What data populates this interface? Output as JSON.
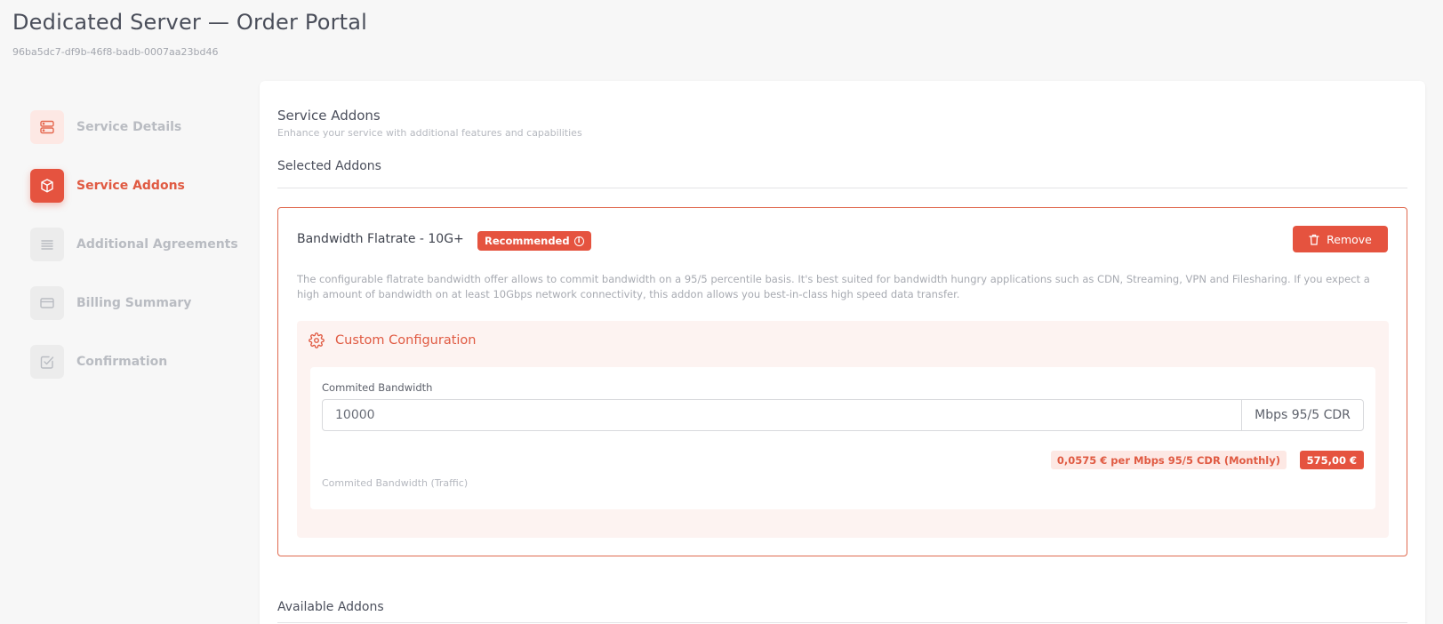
{
  "header": {
    "title": "Dedicated Server — Order Portal",
    "order_id": "96ba5dc7-df9b-46f8-badb-0007aa23bd46"
  },
  "steps": [
    {
      "label": "Service Details",
      "icon": "server-icon",
      "state": "done"
    },
    {
      "label": "Service Addons",
      "icon": "box-icon",
      "state": "active"
    },
    {
      "label": "Additional Agreements",
      "icon": "lines-icon",
      "state": "pending"
    },
    {
      "label": "Billing Summary",
      "icon": "card-icon",
      "state": "pending"
    },
    {
      "label": "Confirmation",
      "icon": "checkbox-icon",
      "state": "pending"
    }
  ],
  "section": {
    "title": "Service Addons",
    "subtitle": "Enhance your service with additional features and capabilities",
    "selected_heading": "Selected Addons",
    "available_heading": "Available Addons"
  },
  "addon": {
    "name": "Bandwidth Flatrate - 10G+",
    "badge": "Recommended",
    "remove_label": "Remove",
    "description": "The configurable flatrate bandwidth offer allows to commit bandwidth on a 95/5 percentile basis. It's best suited for bandwidth hungry applications such as CDN, Streaming, VPN and Filesharing. If you expect a high amount of bandwidth on at least 10Gbps network connectivity, this addon allows you best-in-class high speed data transfer.",
    "config": {
      "heading": "Custom Configuration",
      "field_label": "Commited Bandwidth",
      "value": "10000",
      "unit": "Mbps 95/5 CDR",
      "unit_price": "0,0575 € per Mbps 95/5 CDR (Monthly)",
      "total_price": "575,00 €",
      "field_sub": "Commited Bandwidth (Traffic)"
    }
  },
  "colors": {
    "accent": "#e5533f",
    "accent_text": "#e05a42",
    "accent_soft": "#fde8e4",
    "config_bg": "#fdf3f1",
    "border_accent": "#e06a4f"
  }
}
